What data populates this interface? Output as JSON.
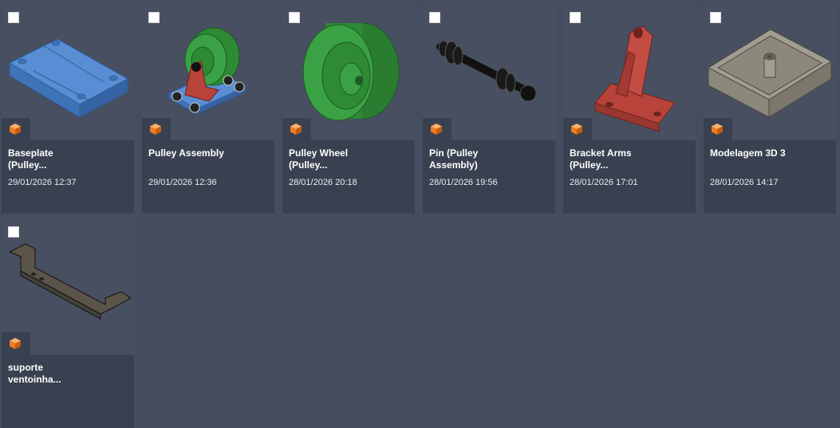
{
  "items": [
    {
      "title_line1": "Baseplate",
      "title_line2": "(Pulley...",
      "date": "29/01/2026 12:37",
      "thumbnail": "baseplate-model",
      "color": "#4a84c8"
    },
    {
      "title_line1": "Pulley Assembly",
      "title_line2": "",
      "date": "29/01/2026 12:36",
      "thumbnail": "pulley-assembly-model",
      "color": "#b8433a"
    },
    {
      "title_line1": "Pulley Wheel",
      "title_line2": "(Pulley...",
      "date": "28/01/2026 20:18",
      "thumbnail": "pulley-wheel-model",
      "color": "#2e8a34"
    },
    {
      "title_line1": "Pin (Pulley",
      "title_line2": "Assembly)",
      "date": "28/01/2026 19:56",
      "thumbnail": "pin-model",
      "color": "#111111"
    },
    {
      "title_line1": "Bracket Arms",
      "title_line2": "(Pulley...",
      "date": "28/01/2026 17:01",
      "thumbnail": "bracket-arms-model",
      "color": "#b8433a"
    },
    {
      "title_line1": "Modelagem 3D 3",
      "title_line2": "",
      "date": "28/01/2026 14:17",
      "thumbnail": "box-model",
      "color": "#8c887b"
    },
    {
      "title_line1": "suporte",
      "title_line2": "ventoinha...",
      "date": "",
      "thumbnail": "bracket-support-model",
      "color": "#5a5548"
    }
  ],
  "icons": {
    "design_type": "cube-icon",
    "accent": "#f07c1e"
  }
}
